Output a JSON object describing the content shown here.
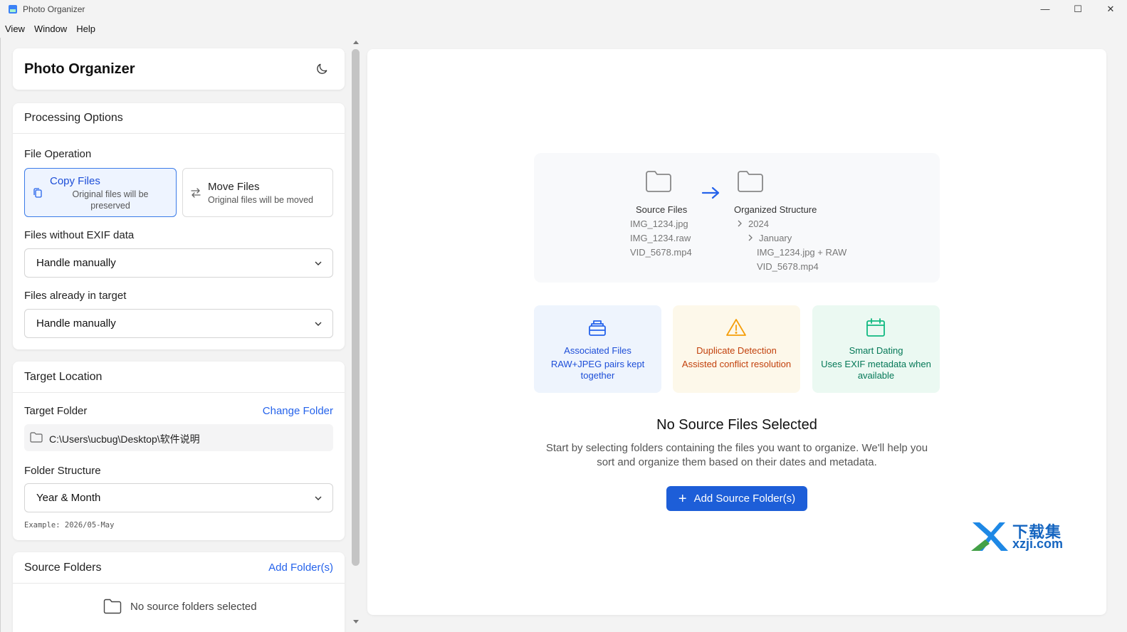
{
  "window": {
    "title": "Photo Organizer",
    "minimize_glyph": "—",
    "maximize_glyph": "☐",
    "close_glyph": "✕"
  },
  "menu": [
    "View",
    "Window",
    "Help"
  ],
  "sidebar": {
    "app_title": "Photo Organizer",
    "theme_icon": "moon-icon",
    "processing": {
      "title": "Processing Options",
      "file_operation_label": "File Operation",
      "copy": {
        "title": "Copy Files",
        "subtitle": "Original files will be preserved",
        "selected": true
      },
      "move": {
        "title": "Move Files",
        "subtitle": "Original files will be moved",
        "selected": false
      },
      "no_exif_label": "Files without EXIF data",
      "no_exif_value": "Handle manually",
      "in_target_label": "Files already in target",
      "in_target_value": "Handle manually"
    },
    "target": {
      "title": "Target Location",
      "folder_label": "Target Folder",
      "change_folder": "Change Folder",
      "path": "C:\\Users\\ucbug\\Desktop\\软件说明",
      "structure_label": "Folder Structure",
      "structure_value": "Year & Month",
      "example": "Example: 2026/05-May"
    },
    "sources": {
      "title": "Source Folders",
      "add_link": "Add Folder(s)",
      "empty_text": "No source folders selected"
    }
  },
  "main": {
    "diagram": {
      "source_label": "Source Files",
      "source_files": [
        "IMG_1234.jpg",
        "IMG_1234.raw",
        "VID_5678.mp4"
      ],
      "target_label": "Organized Structure",
      "year": "2024",
      "month": "January",
      "organized_files": [
        "IMG_1234.jpg + RAW",
        "VID_5678.mp4"
      ]
    },
    "features": [
      {
        "title": "Associated Files",
        "subtitle": "RAW+JPEG pairs kept together",
        "icon": "stack-icon"
      },
      {
        "title": "Duplicate Detection",
        "subtitle": "Assisted conflict resolution",
        "icon": "warning-icon"
      },
      {
        "title": "Smart Dating",
        "subtitle": "Uses EXIF metadata when available",
        "icon": "calendar-icon"
      }
    ],
    "empty_title": "No Source Files Selected",
    "empty_description": "Start by selecting folders containing the files you want to organize. We'll help you sort and organize them based on their dates and metadata.",
    "add_button": "Add Source Folder(s)"
  },
  "watermark": {
    "cn": "下载集",
    "en": "xzji.com"
  },
  "colors": {
    "accent": "#1d5ed8",
    "link": "#2563eb",
    "feature_blue": "#1d4ed8",
    "feature_amber": "#c2410c",
    "feature_green": "#047857"
  }
}
